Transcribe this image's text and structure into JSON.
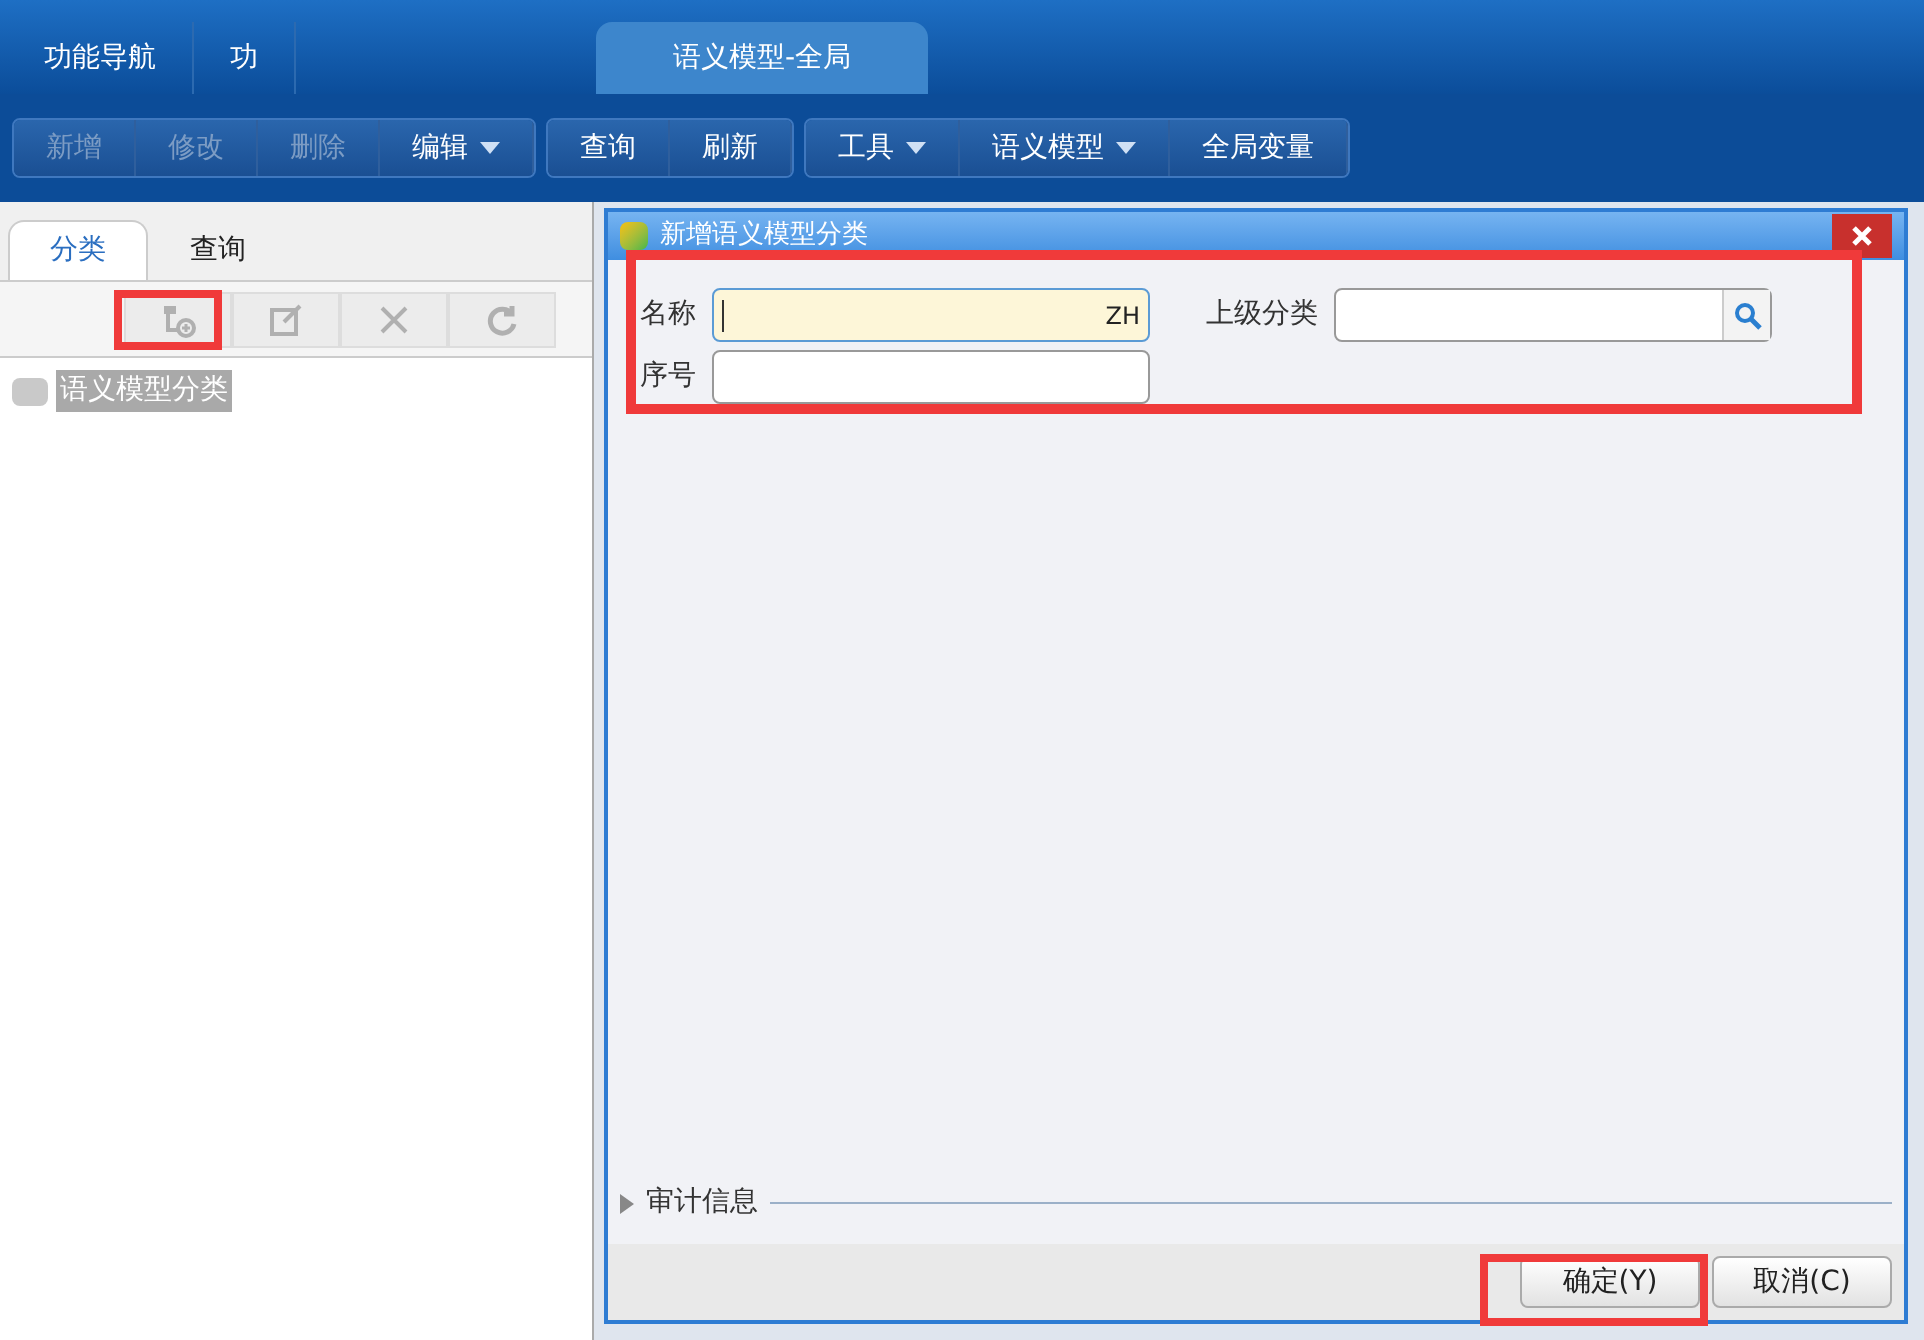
{
  "top_tabs": [
    {
      "label": "功能导航",
      "selected": false
    },
    {
      "label": "功",
      "selected": false
    },
    {
      "label": "语义模型-全局",
      "selected": true
    }
  ],
  "toolbar_groups": [
    [
      {
        "label": "新增",
        "disabled": true,
        "dropdown": false
      },
      {
        "label": "修改",
        "disabled": true,
        "dropdown": false
      },
      {
        "label": "删除",
        "disabled": true,
        "dropdown": false
      },
      {
        "label": "编辑",
        "disabled": false,
        "dropdown": true
      }
    ],
    [
      {
        "label": "查询",
        "disabled": false,
        "dropdown": false
      },
      {
        "label": "刷新",
        "disabled": false,
        "dropdown": false
      }
    ],
    [
      {
        "label": "工具",
        "disabled": false,
        "dropdown": true
      },
      {
        "label": "语义模型",
        "disabled": false,
        "dropdown": true
      },
      {
        "label": "全局变量",
        "disabled": false,
        "dropdown": false
      }
    ]
  ],
  "left_tabs": [
    {
      "label": "分类",
      "selected": true
    },
    {
      "label": "查询",
      "selected": false
    }
  ],
  "tree": [
    {
      "label": "语义模型分类",
      "selected": true
    }
  ],
  "dialog": {
    "title": "新增语义模型分类",
    "fields": [
      {
        "label": "名称",
        "focused": true,
        "ime": "ZH",
        "lookup": false
      },
      {
        "label": "上级分类",
        "focused": false,
        "lookup": true
      },
      {
        "label": "序号",
        "focused": false,
        "lookup": false
      }
    ],
    "section": {
      "label": "审计信息",
      "expanded": false
    },
    "buttons": [
      "确定(Y)",
      "取消(C)"
    ]
  }
}
